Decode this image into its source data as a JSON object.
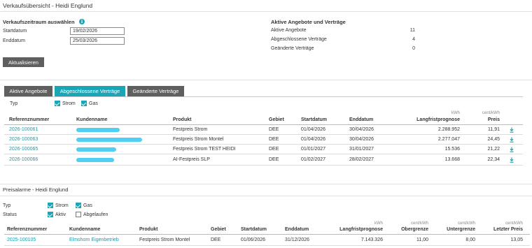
{
  "header": {
    "title": "Verkaufsübersicht - Heidi Englund"
  },
  "period": {
    "heading": "Verkaufszeitraum auswählen",
    "start_label": "Startdatum",
    "start_value": "19/02/2026",
    "end_label": "Enddatum",
    "end_value": "25/03/2026",
    "refresh_label": "Aktualisieren"
  },
  "summary": {
    "heading": "Aktive Angebote und Verträge",
    "rows": [
      {
        "label": "Aktive Angebote",
        "value": "11"
      },
      {
        "label": "Abgeschlossene Verträge",
        "value": "4"
      },
      {
        "label": "Geänderte Verträge",
        "value": "0"
      }
    ]
  },
  "tabs": {
    "items": [
      "Aktive Angebote",
      "Abgeschlossene Verträge",
      "Geänderte Verträge"
    ],
    "active_index": 1
  },
  "contracts_filter": {
    "type_label": "Typ",
    "strom": {
      "label": "Strom",
      "checked": true
    },
    "gas": {
      "label": "Gas",
      "checked": true
    }
  },
  "contracts_table": {
    "headers": {
      "ref": "Referenznummer",
      "customer": "Kundenname",
      "product": "Produkt",
      "area": "Gebiet",
      "start": "Startdatum",
      "end": "Enddatum",
      "forecast_unit": "kWh",
      "forecast": "Langfristprognose",
      "price_unit": "cent/kWh",
      "price": "Preis"
    },
    "rows": [
      {
        "ref": "2026-100061",
        "product": "Festpreis Strom",
        "area": "DEE",
        "start": "01/04/2026",
        "end": "30/04/2026",
        "forecast": "2.288.952",
        "price": "11,91"
      },
      {
        "ref": "2026-100063",
        "product": "Festpreis Strom Montel",
        "area": "DEE",
        "start": "01/04/2026",
        "end": "30/04/2026",
        "forecast": "2.277.047",
        "price": "24,45"
      },
      {
        "ref": "2026-100065",
        "product": "Festpreis Strom TEST HEIDI",
        "area": "DEE",
        "start": "01/01/2027",
        "end": "31/01/2027",
        "forecast": "15.536",
        "price": "21,22"
      },
      {
        "ref": "2026-100066",
        "product": "AI-Festpreis SLP",
        "area": "DEE",
        "start": "01/02/2027",
        "end": "28/02/2027",
        "forecast": "13.668",
        "price": "22,34"
      }
    ]
  },
  "alarms": {
    "heading": "Preisalarme - Heidi Englund",
    "type_label": "Typ",
    "strom": {
      "label": "Strom",
      "checked": true
    },
    "gas": {
      "label": "Gas",
      "checked": true
    },
    "status_label": "Status",
    "active": {
      "label": "Aktiv",
      "checked": true
    },
    "expired": {
      "label": "Abgelaufen",
      "checked": false
    },
    "headers": {
      "ref": "Referenznummer",
      "customer": "Kundenname",
      "product": "Produkt",
      "area": "Gebiet",
      "start": "Startdatum",
      "end": "Enddatum",
      "forecast_unit": "kWh",
      "forecast": "Langfristprognose",
      "upper_unit": "cent/kWh",
      "upper": "Obergrenze",
      "lower_unit": "cent/kWh",
      "lower": "Untergrenze",
      "last_unit": "cent/kWh",
      "last": "Letzter Preis"
    },
    "rows": [
      {
        "ref": "2025-100105",
        "customer": "Elmshorn Eigenbetrieb",
        "product": "Festpreis Strom Montel",
        "area": "DEE",
        "start": "01/06/2026",
        "end": "31/12/2026",
        "forecast": "7.143.326",
        "upper": "11,00",
        "lower": "8,00",
        "last": "13,05"
      }
    ]
  },
  "icons": {
    "info": "info-icon",
    "download": "download-icon",
    "check": "check-icon"
  },
  "colors": {
    "accent": "#1aa6b7",
    "button": "#5f5f5f",
    "redaction": "#4fd0f2"
  }
}
